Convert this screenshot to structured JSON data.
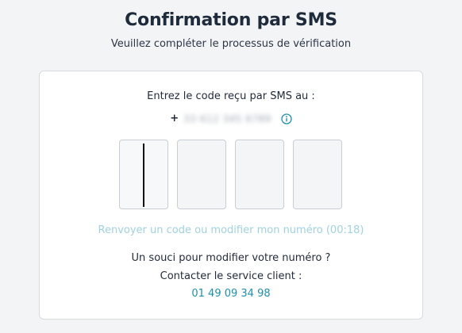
{
  "page": {
    "title": "Confirmation par SMS",
    "subtitle": "Veuillez compléter le processus de vérification"
  },
  "card": {
    "prompt": "Entrez le code reçu par SMS au :",
    "phone_prefix": "+",
    "phone_masked": "33 612 345 6789",
    "info_icon": "info-circle-icon",
    "code_digits": [
      "",
      "",
      "",
      ""
    ],
    "resend_label": "Renvoyer un code ou modifier mon numéro (00:18)",
    "help_line_1": "Un souci pour modifier votre numéro ?",
    "help_line_2": "Contacter le service client :",
    "support_phone": "01 49 09 34 98"
  },
  "colors": {
    "accent": "#1f8fb0",
    "resend_disabled": "#9fd2e0",
    "title": "#1e2b3b"
  }
}
